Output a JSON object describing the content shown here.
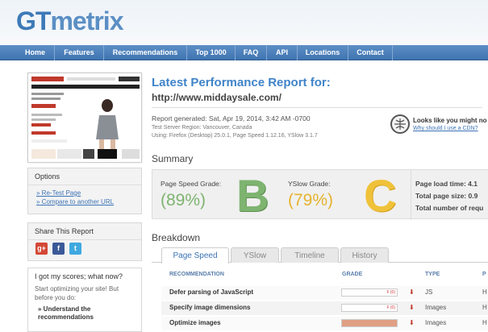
{
  "header": {
    "logo_prefix": "GT",
    "logo_suffix": "metrix"
  },
  "nav": [
    {
      "label": "Home"
    },
    {
      "label": "Features"
    },
    {
      "label": "Recommendations"
    },
    {
      "label": "Top 1000"
    },
    {
      "label": "FAQ"
    },
    {
      "label": "API"
    },
    {
      "label": "Locations"
    },
    {
      "label": "Contact"
    }
  ],
  "options": {
    "title": "Options",
    "links": [
      "» Re-Test Page",
      "» Compare to another URL"
    ]
  },
  "share": {
    "title": "Share This Report"
  },
  "scores": {
    "title": "I got my scores; what now?",
    "text": "Start optimizing your site! But before you do:",
    "bullet": "» Understand the recommendations"
  },
  "report": {
    "title": "Latest Performance Report for:",
    "url": "http://www.middaysale.com/",
    "generated": "Report generated: Sat, Apr 19, 2014, 3:42 AM -0700",
    "server": "Test Server Region: Vancouver, Canada",
    "using": "Using: Firefox (Desktop) 25.0.1, Page Speed 1.12.16, YSlow 3.1.7",
    "cdn_title": "Looks like you might no",
    "cdn_link": "Why should I use a CDN?",
    "summary_heading": "Summary",
    "breakdown_heading": "Breakdown"
  },
  "summary": {
    "pagespeed_label": "Page Speed Grade:",
    "pagespeed_pct": "(89%)",
    "pagespeed_letter": "B",
    "yslow_label": "YSlow Grade:",
    "yslow_pct": "(79%)",
    "yslow_letter": "C",
    "load_time_label": "Page load time: 4.1",
    "total_size_label": "Total page size: 0.9",
    "requests_label": "Total number of requ"
  },
  "tabs": [
    "Page Speed",
    "YSlow",
    "Timeline",
    "History"
  ],
  "table": {
    "headers": [
      "RECOMMENDATION",
      "GRADE",
      "TYPE",
      "P"
    ],
    "rows": [
      {
        "label": "Defer parsing of JavaScript",
        "grade": "F (0)",
        "type": "JS",
        "prio": "H"
      },
      {
        "label": "Specify image dimensions",
        "grade": "F (0)",
        "type": "Images",
        "prio": "H"
      },
      {
        "label": "Optimize images",
        "grade": "",
        "type": "Images",
        "prio": "H"
      }
    ]
  },
  "colors": {
    "accent": "#3f83c9",
    "nav": "#4a7fbb",
    "grade_b": "#7eb46f",
    "grade_c": "#f0c23a"
  }
}
